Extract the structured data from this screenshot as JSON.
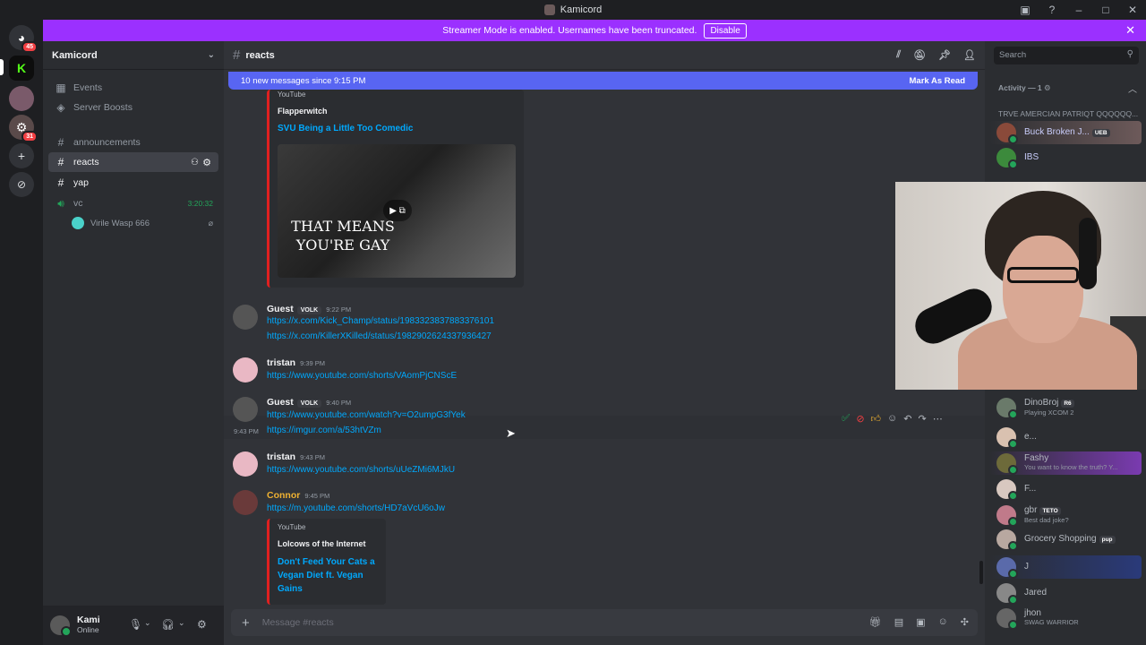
{
  "window": {
    "title": "Kamicord"
  },
  "servers": [
    {
      "icon": "discord-icon",
      "badge": "45"
    },
    {
      "icon": "kick-icon",
      "badge": ""
    },
    {
      "icon": "server-avatar-icon",
      "badge": ""
    },
    {
      "icon": "server-avatar-icon",
      "badge": "31"
    }
  ],
  "banner": {
    "text": "Streamer Mode is enabled. Usernames have been truncated.",
    "button": "Disable"
  },
  "guild": {
    "name": "Kamicord"
  },
  "sidebar": {
    "events": "Events",
    "boosts": "Server Boosts",
    "channels": [
      {
        "name": "announcements"
      },
      {
        "name": "reacts"
      },
      {
        "name": "yap"
      }
    ],
    "voice": {
      "name": "vc",
      "timer": "3:20:32",
      "member": "Virile Wasp 666"
    }
  },
  "user": {
    "name": "Kami",
    "status": "Online"
  },
  "channel": {
    "name": "reacts",
    "composer_placeholder": "Message #reacts"
  },
  "newbar": {
    "text": "10 new messages since 9:15 PM",
    "action": "Mark As Read"
  },
  "embed1": {
    "provider": "YouTube",
    "author": "Flapperwitch",
    "title": "SVU Being a Little Too Comedic",
    "caption": "THAT MEANS YOU'RE GAY"
  },
  "messages": [
    {
      "user": "Guest",
      "tag": "VOLK",
      "time": "9:22 PM",
      "links": [
        "https://x.com/Kick_Champ/status/1983323837883376101",
        "https://x.com/KillerXKilled/status/1982902624337936427"
      ]
    },
    {
      "user": "tristan",
      "time": "9:39 PM",
      "links": [
        "https://www.youtube.com/shorts/VAomPjCNScE"
      ]
    },
    {
      "user": "Guest",
      "tag": "VOLK",
      "time": "9:40 PM",
      "links": [
        "https://www.youtube.com/watch?v=O2umpG3fYek"
      ]
    },
    {
      "sidetime": "9:43 PM",
      "links": [
        "https://imgur.com/a/53htVZm"
      ]
    },
    {
      "user": "tristan",
      "time": "9:43 PM",
      "links": [
        "https://www.youtube.com/shorts/uUeZMi6MJkU"
      ]
    },
    {
      "user": "Connor",
      "time": "9:45 PM",
      "links": [
        "https://m.youtube.com/shorts/HD7aVcU6oJw"
      ]
    }
  ],
  "embed2": {
    "provider": "YouTube",
    "author": "Lolcows of the Internet",
    "title": "Don't Feed Your Cats a Vegan Diet ft. Vegan Gains"
  },
  "members": {
    "search_placeholder": "Search",
    "activity_header": "Activity — 1",
    "group_header": "TRVE AMERCIAN PATRIQT QQQQQQ...",
    "top": [
      {
        "name": "Buck Broken J...",
        "tag": "UEB"
      },
      {
        "name": "IBS"
      }
    ],
    "list": [
      {
        "name": "DinoBroj",
        "tag": "R6",
        "sub": "Playing XCOM 2"
      },
      {
        "name": "e..."
      },
      {
        "name": "Fashy",
        "sub": "You want to know the truth? Y..."
      },
      {
        "name": "F..."
      },
      {
        "name": "gbr",
        "tag": "TETO",
        "sub": "Best dad joke?"
      },
      {
        "name": "Grocery Shopping",
        "tag": "pup"
      },
      {
        "name": "J"
      },
      {
        "name": "Jared"
      },
      {
        "name": "jhon",
        "sub": "SWAG WARRIOR"
      }
    ]
  },
  "colors": {
    "accent": "#5865f2",
    "banner": "#9b30ff",
    "link": "#00a8fc",
    "connor": "#f0b232",
    "online": "#23a55a"
  }
}
